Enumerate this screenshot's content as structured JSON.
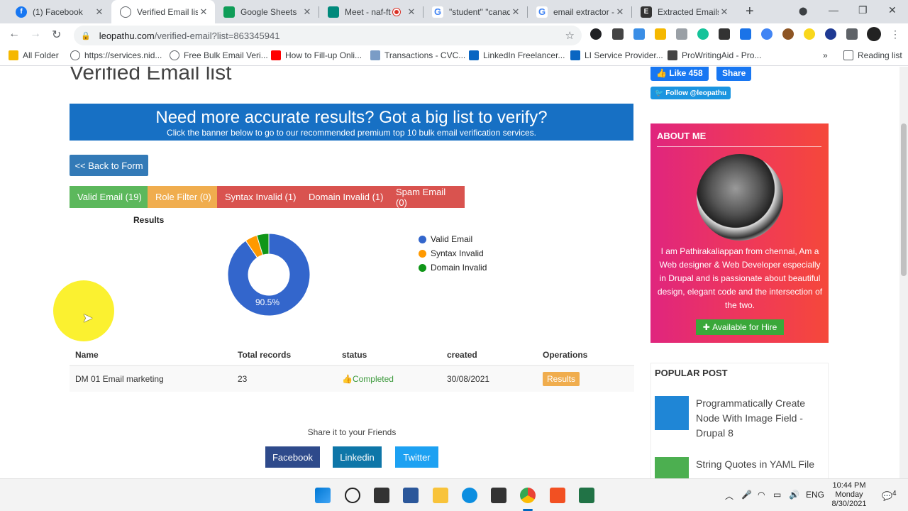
{
  "browser": {
    "tabs": [
      {
        "label": "(1) Facebook",
        "icon": "facebook-icon",
        "color": "#1877f2"
      },
      {
        "label": "Verified Email list",
        "icon": "globe-icon",
        "color": "#5f6368"
      },
      {
        "label": "Google Sheets",
        "icon": "sheets-icon",
        "color": "#0f9d58"
      },
      {
        "label": "Meet - naf-ft",
        "icon": "meet-icon",
        "color": "#00897b"
      },
      {
        "label": "\"student\" \"canad",
        "icon": "google-icon",
        "color": "#4285f4"
      },
      {
        "label": "email extractor -",
        "icon": "google-icon",
        "color": "#4285f4"
      },
      {
        "label": "Extracted Emails",
        "icon": "e-icon",
        "color": "#333333"
      }
    ],
    "url_domain": "leopathu.com",
    "url_path": "/verified-email?list=863345941",
    "bookmarks": [
      {
        "label": "All Folder",
        "icon": "folder-icon"
      },
      {
        "label": "https://services.nid...",
        "icon": "globe-icon"
      },
      {
        "label": "Free Bulk Email Veri...",
        "icon": "globe-icon"
      },
      {
        "label": "How to Fill-up Onli...",
        "icon": "youtube-icon"
      },
      {
        "label": "Transactions - CVC...",
        "icon": "cvc-icon"
      },
      {
        "label": "LinkedIn Freelancer...",
        "icon": "linkedin-icon"
      },
      {
        "label": "LI Service Provider...",
        "icon": "linkedin-icon"
      },
      {
        "label": "ProWritingAid - Pro...",
        "icon": "prowritingaid-icon"
      }
    ],
    "more_bookmarks": "»",
    "reading_list": "Reading list"
  },
  "page": {
    "heading": "Verified Email list",
    "banner_title": "Need more accurate results? Got a big list to verify?",
    "banner_subtitle": "Click the banner below to go to our recommended premium top 10 bulk email verification services.",
    "back_button": "<< Back to Form",
    "filter_tabs": [
      {
        "label": "Valid Email (19)",
        "color": "#5cb85c"
      },
      {
        "label": "Role Filter (0)",
        "color": "#f0ad4e"
      },
      {
        "label": "Syntax Invalid (1)",
        "color": "#d9534f"
      },
      {
        "label": "Domain Invalid (1)",
        "color": "#d9534f"
      },
      {
        "label": "Spam Email (0)",
        "color": "#d9534f"
      }
    ]
  },
  "chart_data": {
    "type": "pie",
    "title": "Results",
    "categories": [
      "Valid Email",
      "Syntax Invalid",
      "Domain Invalid"
    ],
    "values": [
      19,
      1,
      1
    ],
    "colors": [
      "#3366cc",
      "#ff9900",
      "#109618"
    ],
    "data_labels": [
      "90.5%",
      "",
      ""
    ],
    "legend_position": "right",
    "donut": true
  },
  "table": {
    "headers": [
      "Name",
      "Total records",
      "status",
      "created",
      "Operations"
    ],
    "rows": [
      {
        "name": "DM 01 Email marketing",
        "total": "23",
        "status": "Completed",
        "created": "30/08/2021",
        "operation": "Results"
      }
    ]
  },
  "share": {
    "text": "Share it to your Friends",
    "buttons": [
      "Facebook",
      "Linkedin",
      "Twitter"
    ]
  },
  "sidebar": {
    "like_label": "Like 458",
    "share_label": "Share",
    "twitter_follow": "Follow @leopathu",
    "about_title": "ABOUT ME",
    "about_text": "I am Pathirakaliappan from chennai, Am a Web designer & Web Developer especially in Drupal and is passionate about beautiful design, elegant code and the intersection of the two.",
    "hire_button": "Available for Hire",
    "popular_title": "POPULAR POST",
    "posts": [
      "Programmatically Create Node With Image Field - Drupal 8",
      "String Quotes in YAML File"
    ]
  },
  "taskbar": {
    "language": "ENG",
    "time": "10:44 PM",
    "day": "Monday",
    "date": "8/30/2021",
    "notifications": "4"
  }
}
